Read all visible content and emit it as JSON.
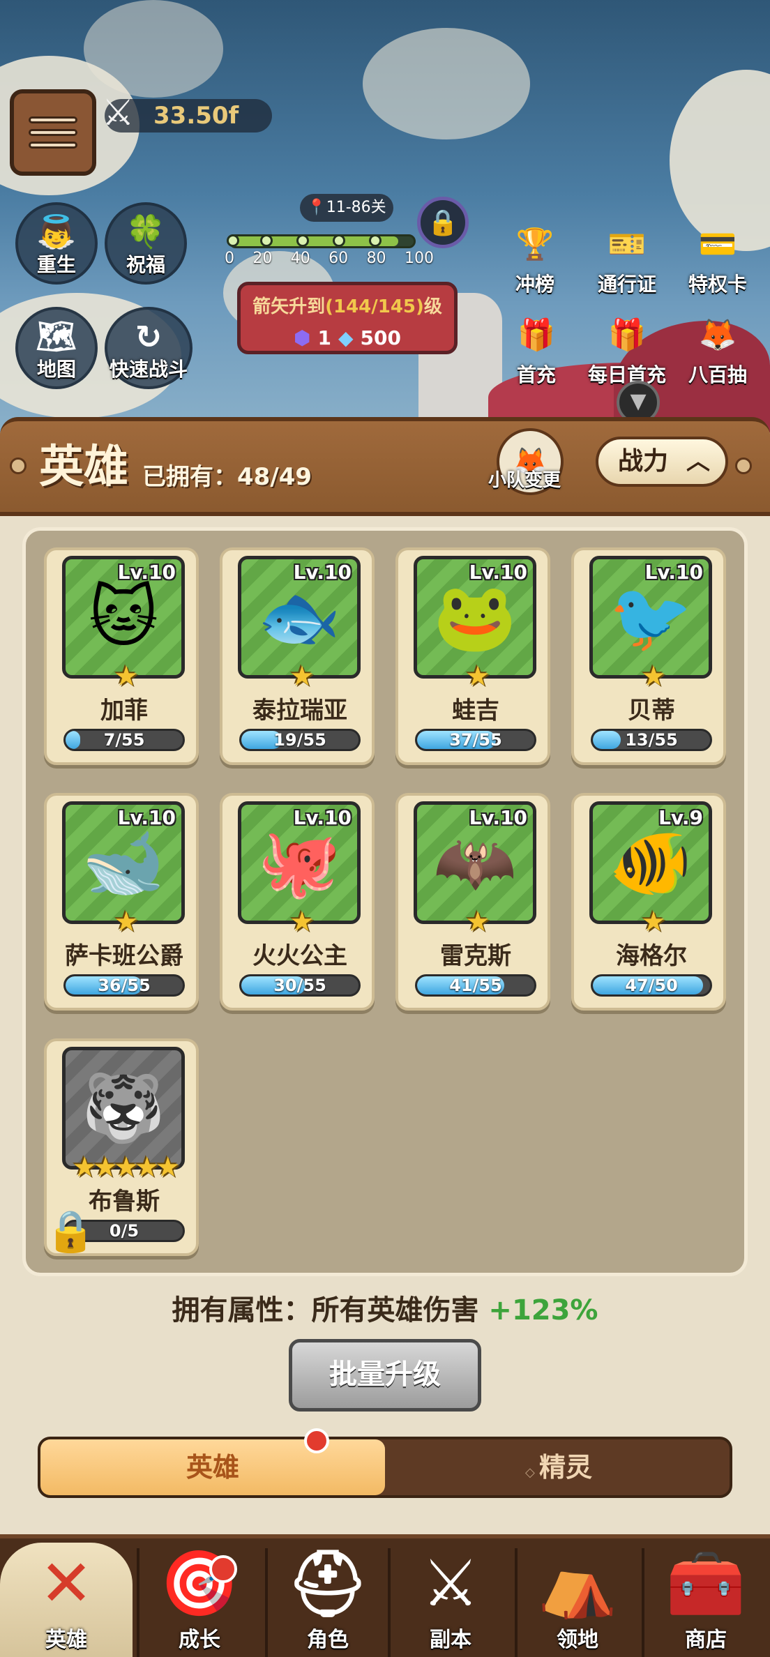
{
  "header": {
    "menu_icon": "menu-icon",
    "combat_power": "33.50f",
    "stage": "11-86关",
    "progress_ticks": [
      "0",
      "20",
      "40",
      "60",
      "80",
      "100"
    ],
    "progress_level": 1.0,
    "upgrade_prefix": "箭矢升到",
    "upgrade_level": "(144/145)",
    "upgrade_suffix": "级",
    "upgrade_cost_a": "1",
    "upgrade_cost_b": "500"
  },
  "left_buttons": [
    {
      "label": "重生",
      "icon": "rebirth-icon"
    },
    {
      "label": "祝福",
      "icon": "blessing-icon"
    },
    {
      "label": "地图",
      "icon": "map-icon"
    },
    {
      "label": "快速战斗",
      "icon": "quick-battle-icon"
    }
  ],
  "event_buttons": [
    {
      "label": "冲榜",
      "icon": "trophy-icon"
    },
    {
      "label": "通行证",
      "icon": "pass-icon"
    },
    {
      "label": "特权卡",
      "icon": "privilege-card-icon"
    },
    {
      "label": "首充",
      "icon": "gift-icon"
    },
    {
      "label": "每日首充",
      "icon": "daily-gift-icon"
    },
    {
      "label": "八百抽",
      "icon": "draw-icon"
    }
  ],
  "panel": {
    "title": "英雄",
    "owned_label": "已拥有：",
    "owned_value": "48/49",
    "squad_label": "小队变更",
    "sort_label": "战力"
  },
  "heroes": [
    {
      "name": "加菲",
      "level": "Lv.10",
      "progress": "7/55",
      "frac": 0.127,
      "stars": "★",
      "emoji": "🐱"
    },
    {
      "name": "泰拉瑞亚",
      "level": "Lv.10",
      "progress": "19/55",
      "frac": 0.345,
      "stars": "★",
      "emoji": "🐟"
    },
    {
      "name": "蛙吉",
      "level": "Lv.10",
      "progress": "37/55",
      "frac": 0.673,
      "stars": "★",
      "emoji": "🐸"
    },
    {
      "name": "贝蒂",
      "level": "Lv.10",
      "progress": "13/55",
      "frac": 0.236,
      "stars": "★",
      "emoji": "🐦"
    },
    {
      "name": "萨卡班公爵",
      "level": "Lv.10",
      "progress": "36/55",
      "frac": 0.655,
      "stars": "★",
      "emoji": "🐋"
    },
    {
      "name": "火火公主",
      "level": "Lv.10",
      "progress": "30/55",
      "frac": 0.545,
      "stars": "★",
      "emoji": "🐙"
    },
    {
      "name": "雷克斯",
      "level": "Lv.10",
      "progress": "41/55",
      "frac": 0.745,
      "stars": "★",
      "emoji": "🦇"
    },
    {
      "name": "海格尔",
      "level": "Lv.9",
      "progress": "47/50",
      "frac": 0.94,
      "stars": "★",
      "emoji": "🐠"
    },
    {
      "name": "布鲁斯",
      "level": "",
      "progress": "0/5",
      "frac": 0,
      "stars": "★★★★★",
      "emoji": "🐯",
      "locked": true
    }
  ],
  "attribute": {
    "label": "拥有属性：所有英雄伤害",
    "value": "+123%"
  },
  "batch_label": "批量升级",
  "tabs": {
    "active": "英雄",
    "inactive": "精灵"
  },
  "nav": [
    {
      "label": "英雄",
      "icon": "close-icon"
    },
    {
      "label": "成长",
      "icon": "growth-icon"
    },
    {
      "label": "角色",
      "icon": "helmet-icon"
    },
    {
      "label": "副本",
      "icon": "swords-icon"
    },
    {
      "label": "领地",
      "icon": "territory-icon"
    },
    {
      "label": "商店",
      "icon": "shop-chest-icon"
    }
  ],
  "colors": {
    "accent_green": "#3da43b",
    "panel_brown": "#8b5a2f",
    "tab_active": "#f3ba64"
  }
}
